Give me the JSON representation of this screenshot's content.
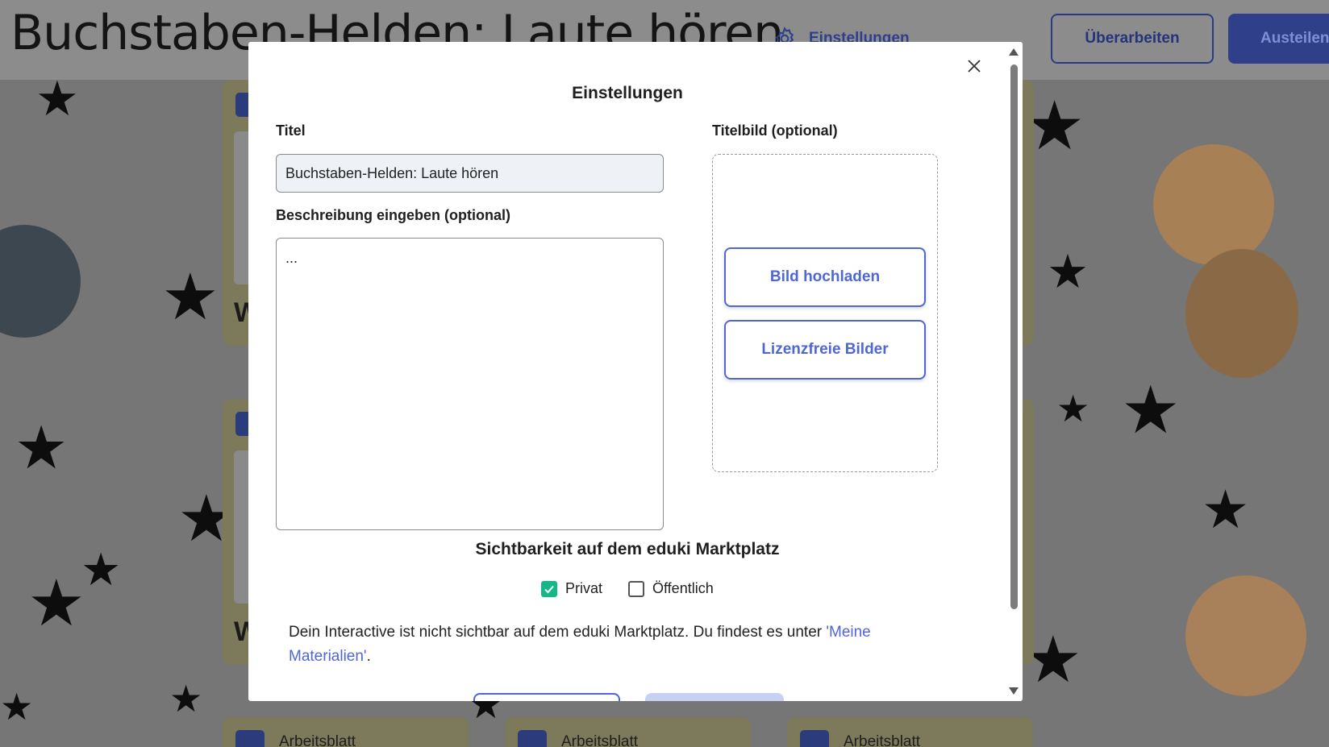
{
  "header": {
    "title": "Buchstaben-Helden: Laute hören",
    "settings_label": "Einstellungen",
    "revise_button": "Überarbeiten",
    "share_button": "Austeilen"
  },
  "background": {
    "card_letters": [
      "W",
      "W"
    ],
    "bottom_cards": [
      "Arbeitsblatt",
      "Arbeitsblatt",
      "Arbeitsblatt"
    ]
  },
  "modal": {
    "title": "Einstellungen",
    "title_label": "Titel",
    "title_value": "Buchstaben-Helden: Laute hören",
    "description_label": "Beschreibung eingeben (optional)",
    "description_value": "...",
    "cover_label": "Titelbild (optional)",
    "upload_button": "Bild hochladen",
    "free_images_button": "Lizenzfreie Bilder",
    "visibility_title": "Sichtbarkeit auf dem eduki Marktplatz",
    "options": [
      {
        "label": "Privat",
        "checked": true
      },
      {
        "label": "Öffentlich",
        "checked": false
      }
    ],
    "info_text": "Dein Interactive ist nicht sichtbar auf dem eduki Marktplatz. Du findest es unter ",
    "info_link": "'Meine Materialien'",
    "info_end": "."
  },
  "colors": {
    "accent": "#4f66d6",
    "checkbox": "#12b886",
    "overlay": "#7a7a7a"
  }
}
